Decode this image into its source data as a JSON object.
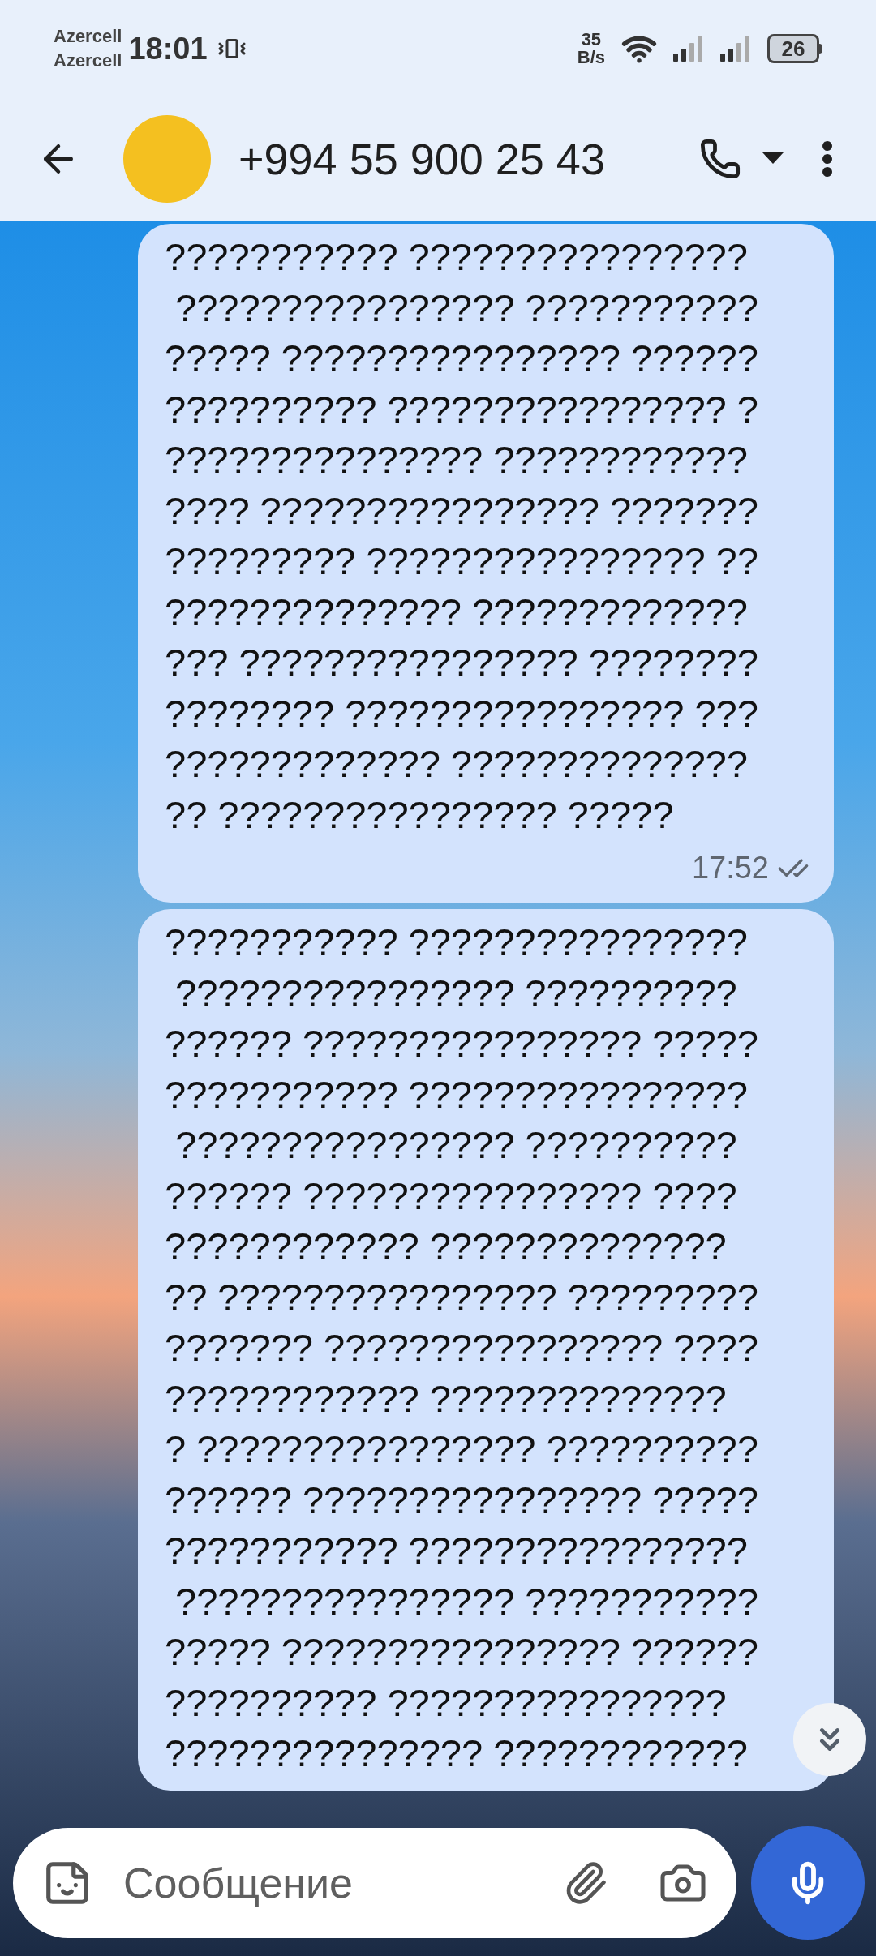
{
  "status_bar": {
    "carriers": [
      "Azercell",
      "Azercell"
    ],
    "time": "18:01",
    "net_speed": [
      "35",
      "B/s"
    ],
    "battery": "26"
  },
  "header": {
    "contact": "+994 55 900 25 43"
  },
  "messages": [
    {
      "text": "??????????? ????????????????\n ???????????????? ???????????\n????? ???????????????? ??????\n?????????? ???????????????? ?\n??????????????? ????????????\n???? ???????????????? ???????\n????????? ???????????????? ??\n?????????????? ?????????????\n??? ???????????????? ????????\n???????? ???????????????? ???\n????????????? ??????????????\n?? ???????????????? ?????",
      "time": "17:52",
      "read": true
    },
    {
      "text": "??????????? ????????????????\n ???????????????? ??????????\n?????? ???????????????? ?????\n??????????? ????????????????\n ???????????????? ??????????\n?????? ???????????????? ????\n???????????? ??????????????\n?? ???????????????? ?????????\n??????? ???????????????? ????\n???????????? ??????????????\n? ???????????????? ??????????\n?????? ???????????????? ?????\n??????????? ????????????????\n ???????????????? ???????????\n????? ???????????????? ??????\n?????????? ????????????????\n??????????????? ????????????"
    }
  ],
  "composer": {
    "placeholder": "Сообщение"
  }
}
